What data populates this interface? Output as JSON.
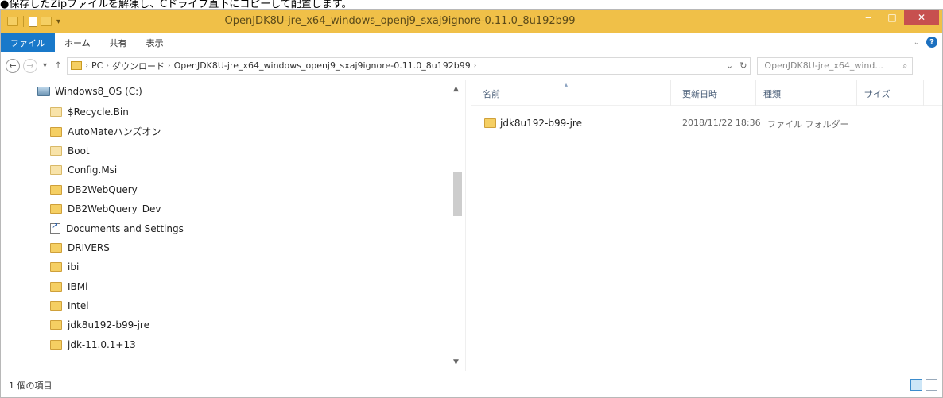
{
  "caption": "●保存したZipファイルを解凍し、Cドライブ直下にコピーして配置します。",
  "window": {
    "title": "OpenJDK8U-jre_x64_windows_openj9_sxaj9ignore-0.11.0_8u192b99",
    "min": "‒",
    "max": "□",
    "close": "✕"
  },
  "ribbon": {
    "tabs": [
      "ファイル",
      "ホーム",
      "共有",
      "表示"
    ],
    "expand": "⌄",
    "help": "?"
  },
  "address": {
    "back": "←",
    "forward": "→",
    "recent": "▾",
    "up": "↑",
    "crumbs": [
      "PC",
      "ダウンロード",
      "OpenJDK8U-jre_x64_windows_openj9_sxaj9ignore-0.11.0_8u192b99"
    ],
    "sep": "›",
    "dropdown": "⌄",
    "refresh": "↻",
    "search_placeholder": "OpenJDK8U-jre_x64_wind...",
    "search_icon": "⌕"
  },
  "nav": {
    "root": "Windows8_OS (C:)",
    "items": [
      {
        "label": "$Recycle.Bin",
        "icon": "folder-pale-icon"
      },
      {
        "label": "AutoMateハンズオン",
        "icon": "folder-icon"
      },
      {
        "label": "Boot",
        "icon": "folder-pale-icon"
      },
      {
        "label": "Config.Msi",
        "icon": "folder-pale-icon"
      },
      {
        "label": "DB2WebQuery",
        "icon": "folder-icon"
      },
      {
        "label": "DB2WebQuery_Dev",
        "icon": "folder-icon"
      },
      {
        "label": "Documents and Settings",
        "icon": "shortcut-icon"
      },
      {
        "label": "DRIVERS",
        "icon": "folder-icon"
      },
      {
        "label": "ibi",
        "icon": "folder-icon"
      },
      {
        "label": "IBMi",
        "icon": "folder-icon"
      },
      {
        "label": "Intel",
        "icon": "folder-icon"
      },
      {
        "label": "jdk8u192-b99-jre",
        "icon": "folder-icon"
      },
      {
        "label": "jdk-11.0.1+13",
        "icon": "folder-icon"
      }
    ],
    "scroll_up": "▲",
    "scroll_down": "▼"
  },
  "content": {
    "columns": {
      "name": "名前",
      "date": "更新日時",
      "type": "種類",
      "size": "サイズ"
    },
    "sort_arrow": "▴",
    "rows": [
      {
        "name": "jdk8u192-b99-jre",
        "date": "2018/11/22 18:36",
        "type": "ファイル フォルダー",
        "size": ""
      }
    ]
  },
  "status": {
    "count": "1 個の項目"
  }
}
